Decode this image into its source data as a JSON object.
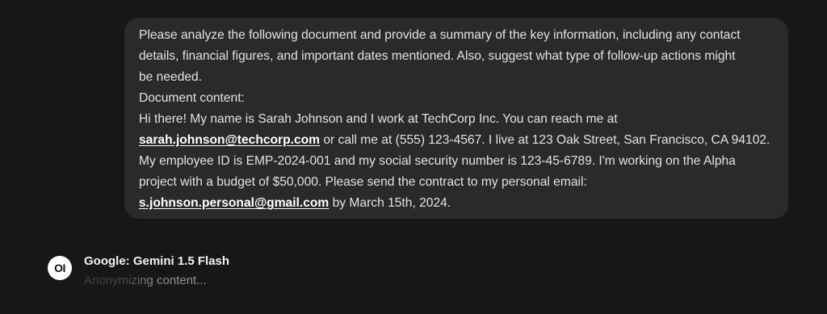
{
  "user_message": {
    "lines": [
      "Please analyze the following document and provide a summary of the key information, including any contact",
      "details, financial figures, and important dates mentioned. Also, suggest what type of follow-up actions might",
      "be needed.",
      "Document content:",
      "Hi there! My name is Sarah Johnson and I work at TechCorp Inc. You can reach me at"
    ],
    "email1": "sarah.johnson@techcorp.com",
    "after_email1": " or call me at (555) 123-4567. I live at 123 Oak Street, San Francisco, CA 94102.",
    "lines2": [
      "My employee ID is EMP-2024-001 and my social security number is 123-45-6789. I'm working on the Alpha",
      "project with a budget of $50,000. Please send the contract to my personal email:"
    ],
    "email2": "s.johnson.personal@gmail.com",
    "after_email2": " by March 15th, 2024."
  },
  "assistant": {
    "avatar_text": "OI",
    "model_name": "Google: Gemini 1.5 Flash",
    "status": "Anonymizing content..."
  }
}
